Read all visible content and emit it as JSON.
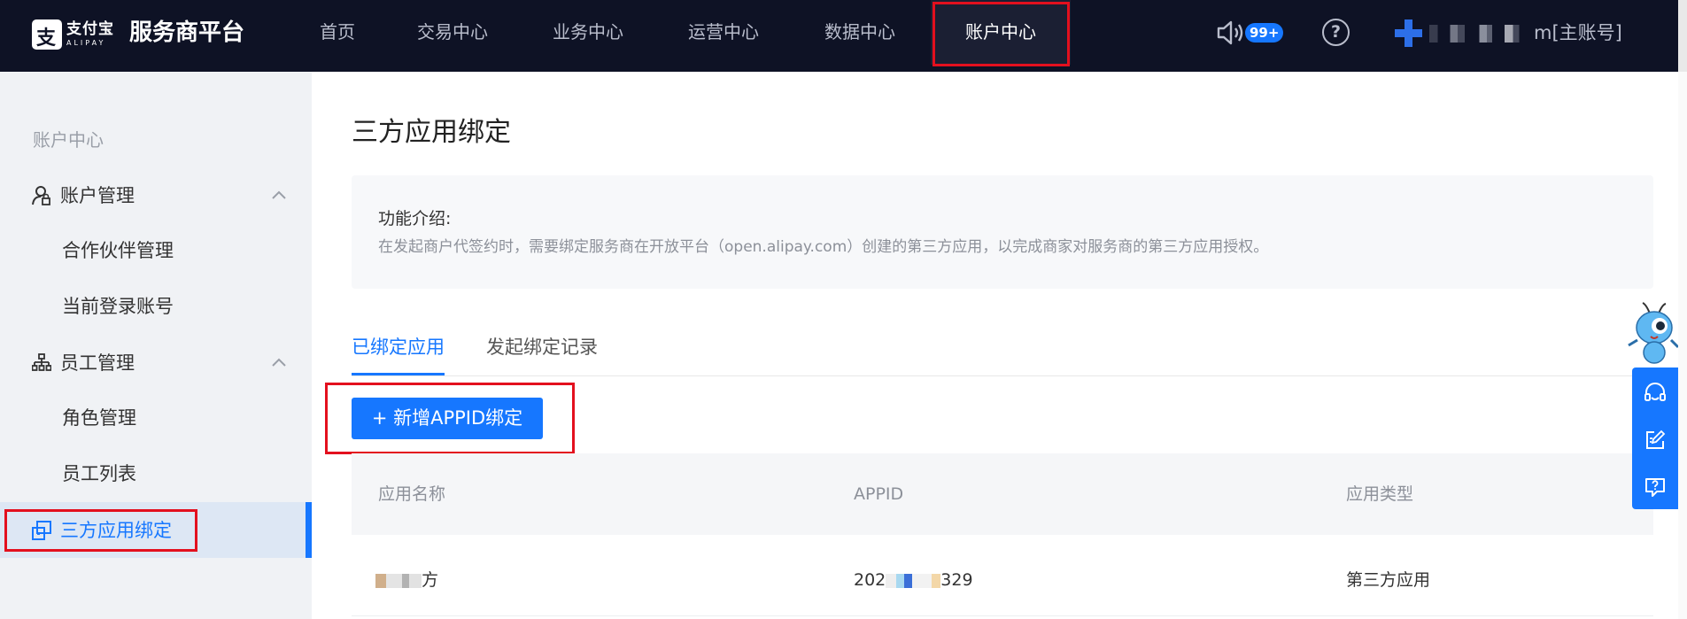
{
  "topbar": {
    "logo_cn": "支付宝",
    "logo_en": "ALIPAY",
    "platform_name": "服务商平台",
    "nav": [
      {
        "label": "首页"
      },
      {
        "label": "交易中心"
      },
      {
        "label": "业务中心"
      },
      {
        "label": "运营中心"
      },
      {
        "label": "数据中心"
      },
      {
        "label": "账户中心",
        "active": true
      }
    ],
    "notification_count": "99+",
    "help_glyph": "?",
    "account_suffix": "m[主账号]"
  },
  "sidebar": {
    "title": "账户中心",
    "groups": [
      {
        "label": "账户管理",
        "icon": "user-lock-icon",
        "items": [
          "合作伙伴管理",
          "当前登录账号"
        ]
      },
      {
        "label": "员工管理",
        "icon": "org-tree-icon",
        "items": [
          "角色管理",
          "员工列表"
        ]
      }
    ],
    "active_item": {
      "label": "三方应用绑定",
      "icon": "app-link-icon"
    }
  },
  "main": {
    "title": "三方应用绑定",
    "intro": {
      "heading": "功能介绍:",
      "text": "在发起商户代签约时，需要绑定服务商在开放平台（open.alipay.com）创建的第三方应用，以完成商家对服务商的第三方应用授权。"
    },
    "tabs": [
      {
        "label": "已绑定应用",
        "active": true
      },
      {
        "label": "发起绑定记录"
      }
    ],
    "add_button": "+ 新增APPID绑定",
    "table": {
      "columns": [
        "应用名称",
        "APPID",
        "应用类型"
      ],
      "rows": [
        {
          "name_tail": "方",
          "appid_head": "202",
          "appid_tail": "329",
          "type": "第三方应用"
        }
      ]
    }
  },
  "colors": {
    "accent": "#1677ff",
    "nav_bg": "#0e1225",
    "highlight": "#e3101e",
    "sidebar_bg": "#f0f2f5"
  },
  "float_tools": [
    "headset-icon",
    "edit-icon",
    "question-icon"
  ]
}
